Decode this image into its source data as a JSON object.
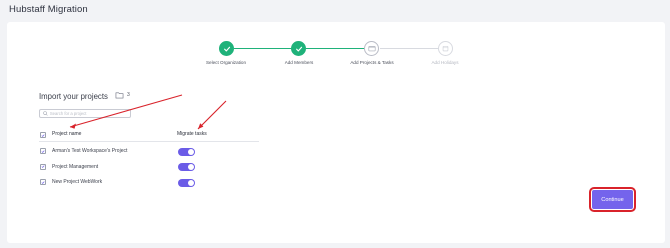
{
  "app_title": "Hubstaff Migration",
  "stepper": {
    "steps": [
      {
        "label": "Select Organization",
        "state": "done"
      },
      {
        "label": "Add Members",
        "state": "done"
      },
      {
        "label": "Add Projects & Tasks",
        "state": "active"
      },
      {
        "label": "Add Holidays",
        "state": "pending"
      }
    ]
  },
  "import": {
    "title": "Import your projects",
    "project_count": "3",
    "search_placeholder": "Search for a project",
    "columns": {
      "name": "Project name",
      "migrate": "Migrate tasks"
    },
    "rows": [
      {
        "name": "Arman's Test Workspace's Project",
        "checked": true,
        "migrate": true
      },
      {
        "name": "Project Management",
        "checked": true,
        "migrate": true
      },
      {
        "name": "New Project WebWork",
        "checked": true,
        "migrate": true
      }
    ]
  },
  "actions": {
    "continue_label": "Continue"
  },
  "colors": {
    "accent": "#7464ec",
    "done": "#1fb27a",
    "annotation": "#d9232b"
  }
}
